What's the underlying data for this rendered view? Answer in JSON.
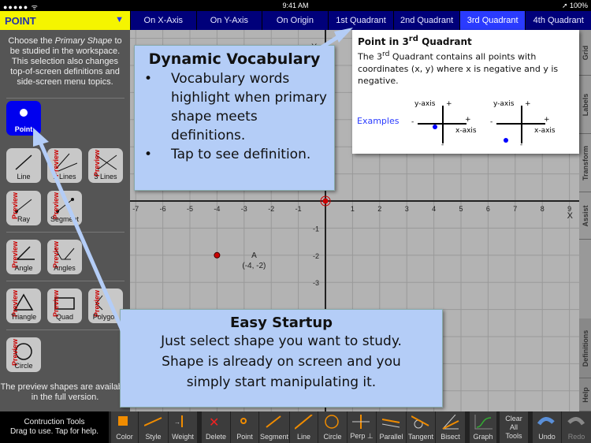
{
  "status": {
    "signal": "●●●●● ᯤ",
    "time": "9:41 AM",
    "battery": "➚ 100%"
  },
  "shape_select": {
    "value": "POINT"
  },
  "tabs": [
    {
      "label": "On X-Axis"
    },
    {
      "label": "On Y-Axis"
    },
    {
      "label": "On Origin"
    },
    {
      "label": "1st Quadrant"
    },
    {
      "label": "2nd Quadrant"
    },
    {
      "label": "3rd Quadrant",
      "active": true
    },
    {
      "label": "4th Quadrant"
    }
  ],
  "left": {
    "intro_pre": "Choose the ",
    "intro_em": "Primary Shape",
    "intro_post": " to be studied in the workspace. This selection also changes top-of-screen definitions and side-screen menu topics.",
    "preview_tag": "Preview",
    "shapes": [
      {
        "label": "Point",
        "selected": true
      },
      {
        "label": "Line"
      },
      {
        "label": "2 Lines",
        "preview": true
      },
      {
        "label": "3 Lines",
        "preview": true
      },
      {
        "label": "Ray",
        "preview": true
      },
      {
        "label": "Segment",
        "preview": true
      },
      {
        "label": "Angle",
        "preview": true
      },
      {
        "label": "Angles",
        "preview": true
      },
      {
        "label": "Triangle",
        "preview": true
      },
      {
        "label": "Quad",
        "preview": true
      },
      {
        "label": "Polygon",
        "preview": true
      },
      {
        "label": "Circle",
        "preview": true
      }
    ],
    "note": "The preview shapes are available in the full version."
  },
  "graph": {
    "x_ticks": [
      -7,
      -6,
      -5,
      -4,
      -3,
      -2,
      -1,
      1,
      2,
      3,
      4,
      5,
      6,
      7,
      8,
      9
    ],
    "y_ticks": [
      -1,
      -2,
      -3
    ],
    "x_axis_label": "X",
    "point": {
      "name": "A",
      "coords": "(-4, -2)",
      "x": -4,
      "y": -2
    },
    "point_color": "#cc0000"
  },
  "right_tabs": [
    "Grid",
    "Labels",
    "Transform",
    "Assist",
    "Definitions",
    "Help"
  ],
  "definition": {
    "title_pre": "Point in 3",
    "title_sup": "rd",
    "title_post": " Quadrant",
    "body_pre": "The 3",
    "body_sup": "rd",
    "body_post": " Quadrant contains all points with coordinates (x, y) where x is negative and y is negative.",
    "examples": "Examples",
    "y_axis": "y-axis",
    "x_axis": "x-axis",
    "plus": "+",
    "minus": "-"
  },
  "callout_vocab": {
    "title": "Dynamic Vocabulary",
    "bullets": [
      "Vocabulary words highlight when primary shape meets definitions.",
      "Tap to see definition."
    ]
  },
  "callout_startup": {
    "title": "Easy Startup",
    "lines": [
      "Just select shape you want to study.",
      "Shape is already on screen and you",
      "simply start manipulating it."
    ]
  },
  "toolbar": {
    "help": "Contruction Tools\nDrag to use. Tap for help.",
    "help1": "Contruction Tools",
    "help2": "Drag to use. Tap for help.",
    "tools": [
      "Color",
      "Style",
      "Weight",
      "Delete",
      "Point",
      "Segment",
      "Line",
      "Circle",
      "Perp ⊥",
      "Parallel",
      "Tangent",
      "Bisect",
      "Graph",
      "Clear All Tools",
      "Undo",
      "Redo"
    ]
  },
  "colors": {
    "accent": "#2a3bff",
    "tab_bg": "#00007a",
    "select_bg": "#f5f500",
    "callout": "#b4cdf7",
    "tool_orange": "#f08c00"
  }
}
